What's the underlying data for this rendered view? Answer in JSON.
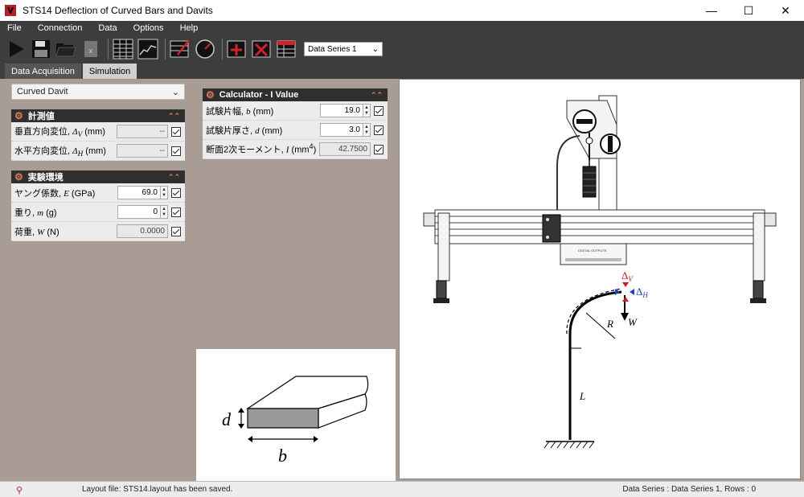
{
  "window": {
    "title": "STS14 Deflection of Curved Bars and Davits",
    "minimize": "—",
    "maximize": "☐",
    "close": "✕"
  },
  "menu": [
    "File",
    "Connection",
    "Data",
    "Options",
    "Help"
  ],
  "toolbar": {
    "series_selected": "Data Series 1"
  },
  "tabs": [
    {
      "label": "Data Acquisition",
      "active": false
    },
    {
      "label": "Simulation",
      "active": true
    }
  ],
  "model_select": "Curved Davit",
  "measurements": {
    "header": "計測値",
    "rows": [
      {
        "label": "垂直方向変位, ",
        "symbol": "Δ",
        "sub": "V",
        "unit": " (mm)",
        "value": "--"
      },
      {
        "label": "水平方向変位, ",
        "symbol": "Δ",
        "sub": "H",
        "unit": " (mm)",
        "value": "--"
      }
    ]
  },
  "environment": {
    "header": "実験環境",
    "rows": [
      {
        "label": "ヤング係数, ",
        "symbol": "E",
        "unit": " (GPa)",
        "value": "69.0"
      },
      {
        "label": "重り, ",
        "symbol": "m",
        "unit": " (g)",
        "value": "0"
      },
      {
        "label": "荷重, ",
        "symbol": "W",
        "unit": " (N)",
        "value": "0.0000"
      }
    ]
  },
  "calculator": {
    "header": "Calculator - I Value",
    "rows": [
      {
        "label": "試験片幅, ",
        "symbol": "b",
        "unit": " (mm)",
        "value": "19.0"
      },
      {
        "label": "試験片厚さ, ",
        "symbol": "d",
        "unit": " (mm)",
        "value": "3.0"
      },
      {
        "label": "断面2次モーメント, ",
        "symbol": "I",
        "unit": " (mm",
        "sup": "4",
        "unit_end": ")",
        "value": "42.7500"
      }
    ]
  },
  "cross_section": {
    "d_label": "d",
    "b_label": "b"
  },
  "apparatus": {
    "delta_v": "Δ",
    "delta_v_sub": "V",
    "delta_h": "Δ",
    "delta_h_sub": "H",
    "r_label": "R",
    "w_label": "W",
    "l_label": "L",
    "device_text": "DIGITAL OUTPUTS"
  },
  "status": {
    "message": "Layout file: STS14.layout has been saved.",
    "series_info": "Data Series : Data Series 1,   Rows : 0"
  },
  "colors": {
    "accent": "#e07a52",
    "brand": "#b31f24",
    "delta_v": "#e0141e",
    "delta_h": "#1a3fd8"
  }
}
